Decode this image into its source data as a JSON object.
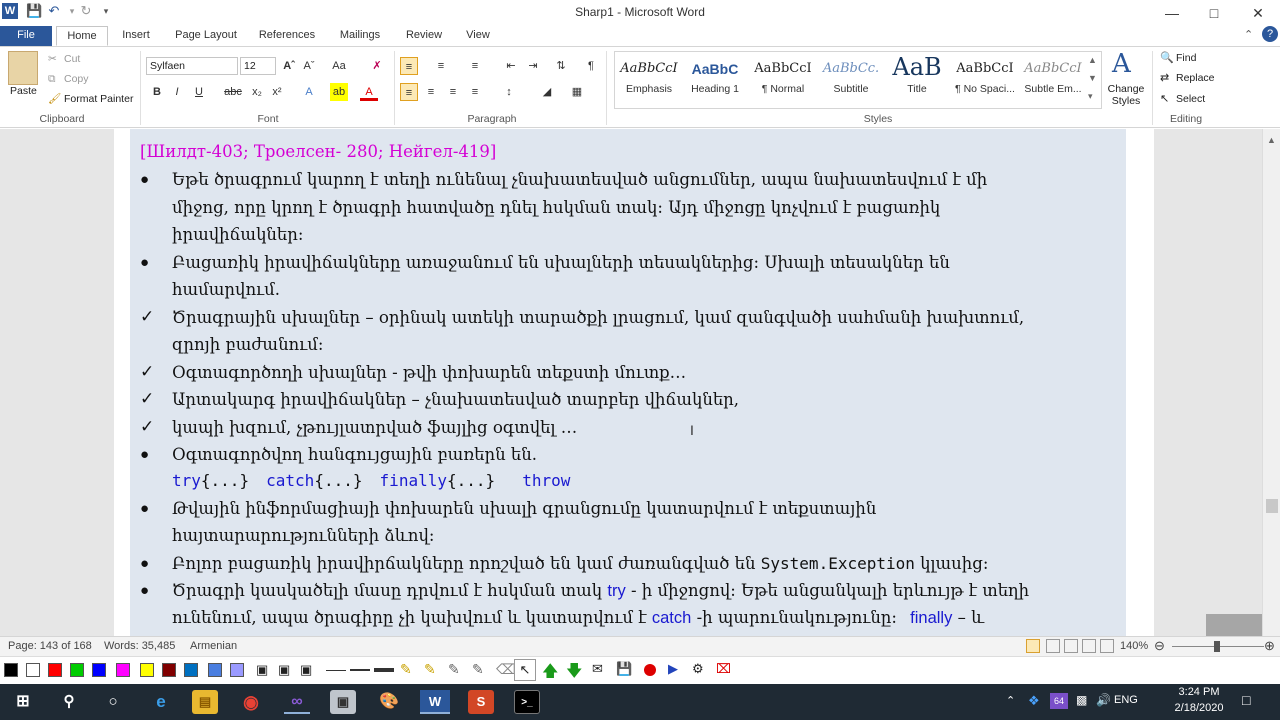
{
  "window": {
    "title": "Sharp1 - Microsoft Word"
  },
  "tabs": [
    "File",
    "Home",
    "Insert",
    "Page Layout",
    "References",
    "Mailings",
    "Review",
    "View"
  ],
  "clipboard": {
    "paste": "Paste",
    "cut": "Cut",
    "copy": "Copy",
    "format_painter": "Format Painter",
    "label": "Clipboard"
  },
  "font": {
    "name": "Sylfaen",
    "size": "12",
    "label": "Font"
  },
  "paragraph": {
    "label": "Paragraph"
  },
  "styles": {
    "label": "Styles",
    "items": [
      {
        "sample": "AaBbCcI",
        "name": "Emphasis"
      },
      {
        "sample": "AaBbC",
        "name": "Heading 1"
      },
      {
        "sample": "AaBbCcI",
        "name": "¶ Normal"
      },
      {
        "sample": "AaBbCc.",
        "name": "Subtitle"
      },
      {
        "sample": "AaB",
        "name": "Title"
      },
      {
        "sample": "AaBbCcI",
        "name": "¶ No Spaci..."
      },
      {
        "sample": "AaBbCcI",
        "name": "Subtle Em..."
      }
    ],
    "change_styles": "Change Styles"
  },
  "editing": {
    "find": "Find",
    "replace": "Replace",
    "select": "Select",
    "label": "Editing"
  },
  "document": {
    "ref_line": "[Шилдт-403; Троелсен- 280; Нейгел-419]",
    "lines": [
      "Եթե ծրագրում  կարող է տեղի ունենալ չնախատեսված  անցումներ,  ապա նախատեսվում է մի",
      "միջոց, որը կրող է  ծրագրի հատվածը դնել  հսկման տակ: Այդ միջոցը կոչվում է բացառիկ",
      "իրավիճակներ:",
      "Բացառիկ իրավիճակները  առաջանում են սխալների  տեսակներից: Սխալի տեսակներ են",
      "համարվում.",
      "Ծրագրային սխալներ – օրինակ ատեկի տարածքի լրացում, կամ զանգվածի սահմանի խախտում,",
      "զրոյի բաժանում:",
      "Օգտագործողի սխալներ - թվի փոխարեն տեքստի մուտք…",
      "Արտակարգ իրավիճակներ – չնախատեսված տարբեր վիճակներ,",
      "կապի խզում, չթույլատրված ֆայլից օգտվել …",
      "Օգտագործվող հանգույցային բառերն են.",
      "Թվային ինֆորմացիայի փոխարեն սխալի գրանցումը կատարվում է տեքստային",
      "հայտարարությունների ձևով:",
      "Բոլոր բացառիկ իրավիրճակները որոշված են կամ ժառանգված են",
      "կլասից:",
      "Ծրագրի կասկածելի մասը դրվում է հսկման տակ",
      "- ի միջոցով: Եթե անցանկալի երևույթ է տեղի",
      "ունենում, ապա ծրագիրը չի կախվում և կատարվում է",
      "-ի պարունակությունը:",
      "– և"
    ],
    "code": {
      "try": "try",
      "catch": "catch",
      "finally": "finally",
      "throw": "throw",
      "braces": "{...}",
      "system_exception": "System.Exception"
    }
  },
  "status": {
    "page": "Page: 143 of 168",
    "words": "Words: 35,485",
    "language": "Armenian",
    "zoom": "140%"
  },
  "taskbar": {
    "time": "3:24 PM",
    "date": "2/18/2020",
    "lang": "ENG",
    "badge": "64"
  }
}
